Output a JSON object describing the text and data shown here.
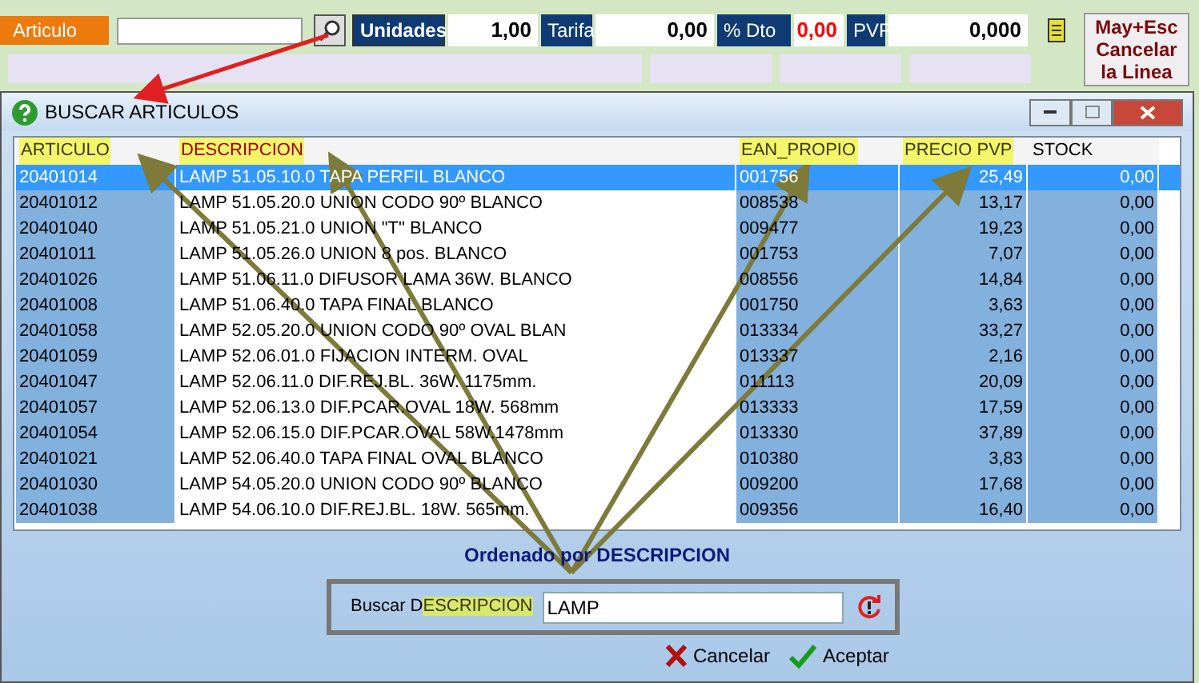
{
  "toolbar": {
    "article_label": "Articulo",
    "units_label": "Unidades",
    "units_value": "1,00",
    "rate_label": "Tarifa",
    "rate_value": "0,00",
    "discount_label": "% Dto",
    "discount_value": "0,00",
    "pvp_label": "PVP",
    "pvp_value": "0,000",
    "cancel_button": [
      "May+Esc",
      "Cancelar",
      "la Linea"
    ]
  },
  "dialog": {
    "title": "BUSCAR ARTICULOS",
    "columns": [
      {
        "label": "ARTICULO",
        "highlighted": true,
        "sorted": false,
        "shaded": true
      },
      {
        "label": "DESCRIPCION",
        "highlighted": true,
        "sorted": true,
        "shaded": false
      },
      {
        "label": "EAN_PROPIO",
        "highlighted": true,
        "sorted": false,
        "shaded": true
      },
      {
        "label": "PRECIO PVP",
        "highlighted": true,
        "sorted": false,
        "shaded": true
      },
      {
        "label": "STOCK",
        "highlighted": false,
        "sorted": false,
        "shaded": true
      }
    ],
    "rows": [
      {
        "selected": true,
        "cells": [
          "20401014",
          "LAMP 51.05.10.0 TAPA PERFIL BLANCO",
          "001756",
          "25,49",
          "0,00"
        ]
      },
      {
        "selected": false,
        "cells": [
          "20401012",
          "LAMP 51.05.20.0 UNION CODO 90º BLANCO",
          "008538",
          "13,17",
          "0,00"
        ]
      },
      {
        "selected": false,
        "cells": [
          "20401040",
          "LAMP 51.05.21.0 UNION \"T\" BLANCO",
          "009477",
          "19,23",
          "0,00"
        ]
      },
      {
        "selected": false,
        "cells": [
          "20401011",
          "LAMP 51.05.26.0 UNION 8 pos. BLANCO",
          "001753",
          "7,07",
          "0,00"
        ]
      },
      {
        "selected": false,
        "cells": [
          "20401026",
          "LAMP 51.06.11.0 DIFUSOR LAMA 36W. BLANCO",
          "008556",
          "14,84",
          "0,00"
        ]
      },
      {
        "selected": false,
        "cells": [
          "20401008",
          "LAMP 51.06.40.0 TAPA FINAL BLANCO",
          "001750",
          "3,63",
          "0,00"
        ]
      },
      {
        "selected": false,
        "cells": [
          "20401058",
          "LAMP 52.05.20.0 UNION CODO 90º OVAL BLAN",
          "013334",
          "33,27",
          "0,00"
        ]
      },
      {
        "selected": false,
        "cells": [
          "20401059",
          "LAMP 52.06.01.0 FIJACION INTERM. OVAL",
          "013337",
          "2,16",
          "0,00"
        ]
      },
      {
        "selected": false,
        "cells": [
          "20401047",
          "LAMP 52.06.11.0 DIF.REJ.BL. 36W. 1175mm.",
          "011113",
          "20,09",
          "0,00"
        ]
      },
      {
        "selected": false,
        "cells": [
          "20401057",
          "LAMP 52.06.13.0 DIF.PCAR.OVAL 18W. 568mm",
          "013333",
          "17,59",
          "0,00"
        ]
      },
      {
        "selected": false,
        "cells": [
          "20401054",
          "LAMP 52.06.15.0 DIF.PCAR.OVAL 58W.1478mm",
          "013330",
          "37,89",
          "0,00"
        ]
      },
      {
        "selected": false,
        "cells": [
          "20401021",
          "LAMP 52.06.40.0 TAPA FINAL OVAL BLANCO",
          "010380",
          "3,83",
          "0,00"
        ]
      },
      {
        "selected": false,
        "cells": [
          "20401030",
          "LAMP 54.05.20.0 UNION CODO 90º BLANCO",
          "009200",
          "17,68",
          "0,00"
        ]
      },
      {
        "selected": false,
        "cells": [
          "20401038",
          "LAMP 54.06.10.0 DIF.REJ.BL. 18W. 565mm.",
          "009356",
          "16,40",
          "0,00"
        ]
      }
    ],
    "sort_caption": "Ordenado por DESCRIPCION",
    "search_label": [
      {
        "text": "Buscar D",
        "highlighted": false
      },
      {
        "text": "ESCRIPCION",
        "highlighted": true
      }
    ],
    "search_value": "LAMP",
    "buttons": [
      {
        "kind": "cancel",
        "label": "Cancelar"
      },
      {
        "kind": "accept",
        "label": "Aceptar"
      }
    ]
  }
}
